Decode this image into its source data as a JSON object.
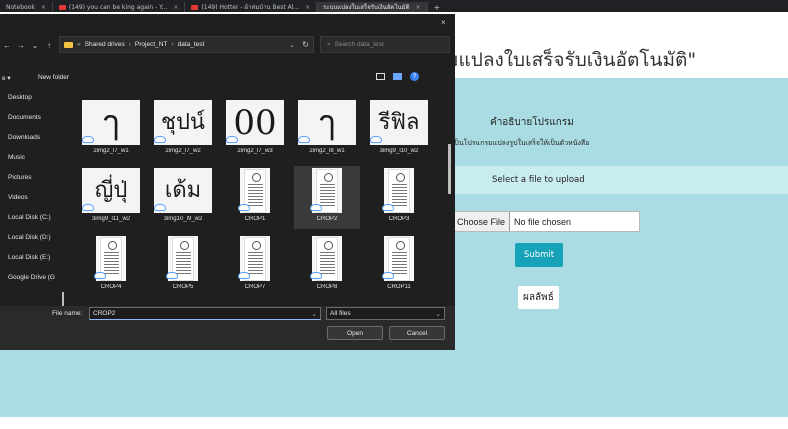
{
  "browser": {
    "tabs": [
      {
        "label": "Notebook",
        "yt": false,
        "active": false
      },
      {
        "label": "(149) you can be king again - Y...",
        "yt": true,
        "active": false
      },
      {
        "label": "(149) Hotter - ผ้าห่มบ้าน Best Al...",
        "yt": true,
        "active": false
      },
      {
        "label": "ระบบแปลงใบเสร็จรับเงินอัตโนมัติ",
        "yt": false,
        "active": true
      }
    ],
    "close_glyph": "×",
    "new_tab_glyph": "+"
  },
  "webpage": {
    "title": "มแปลงใบเสร็จรับเงินอัตโนมัติ\"",
    "description_heading": "คำอธิบายโปรแกรม",
    "description_text": "เป็นโปรแกรมแปลงรูปใบเสร็จให้เป็นตัวหนังสือ",
    "select_label": "Select a file to upload",
    "choose_button": "Choose File",
    "no_file_text": "No file chosen",
    "submit_label": "Submit",
    "result_label": "ผลลัพธ์"
  },
  "dialog": {
    "close_glyph": "×",
    "back_glyph": "←",
    "forward_glyph": "→",
    "down_glyph": "⌄",
    "up_glyph": "↑",
    "breadcrumb": [
      "Shared drives",
      "Project_NT",
      "data_test"
    ],
    "crumb_sep": "›",
    "crumb_lead": "«",
    "path_caret": "⌄",
    "refresh_glyph": "↻",
    "search_glyph": "⌕",
    "search_placeholder": "Search data_test",
    "organize_label": "e ▾",
    "new_folder_label": "New folder",
    "sidebar": [
      "Desktop",
      "Documents",
      "Downloads",
      "Music",
      "Pictures",
      "Videos",
      "Local Disk (C:)",
      "Local Disk (D:)",
      "Local Disk (E:)",
      "Google Drive (G"
    ],
    "files": [
      {
        "name": "2img2_l7_w1",
        "glyph": "ๅ",
        "kind": "handwriting"
      },
      {
        "name": "2img2_l7_w2",
        "glyph": "ชุปน์",
        "kind": "handwriting"
      },
      {
        "name": "2img2_l7_w3",
        "glyph": "00",
        "kind": "handwriting"
      },
      {
        "name": "2img2_l8_w1",
        "glyph": "ๅ",
        "kind": "handwriting"
      },
      {
        "name": "3img9_l10_w2",
        "glyph": "รีฟิล",
        "kind": "handwriting"
      },
      {
        "name": "3img9_l11_w2",
        "glyph": "ญี่ปุ่",
        "kind": "handwriting"
      },
      {
        "name": "3img10_l9_w2",
        "glyph": "เด้ม",
        "kind": "handwriting"
      },
      {
        "name": "CROP1",
        "glyph": "",
        "kind": "receipt"
      },
      {
        "name": "CROP2",
        "glyph": "",
        "kind": "receipt"
      },
      {
        "name": "CROP3",
        "glyph": "",
        "kind": "receipt"
      },
      {
        "name": "CROP4",
        "glyph": "",
        "kind": "receipt"
      },
      {
        "name": "CROP5",
        "glyph": "",
        "kind": "receipt"
      },
      {
        "name": "CROP7",
        "glyph": "",
        "kind": "receipt"
      },
      {
        "name": "CROP8",
        "glyph": "",
        "kind": "receipt"
      },
      {
        "name": "CROP11",
        "glyph": "",
        "kind": "receipt"
      }
    ],
    "selected_file": "CROP2",
    "file_name_label": "File name:",
    "file_name_value": "CROP2",
    "file_type_filter": "All files",
    "dropdown_glyph": "⌄",
    "open_label": "Open",
    "cancel_label": "Cancel"
  },
  "colors": {
    "panel_bg": "#aadde3",
    "strip_bg": "#c9ecf0",
    "submit_bg": "#17a2b8",
    "dialog_bg": "#1f1f1f",
    "folder_icon": "#f3c342",
    "cloud_icon": "#5aa0ff"
  }
}
